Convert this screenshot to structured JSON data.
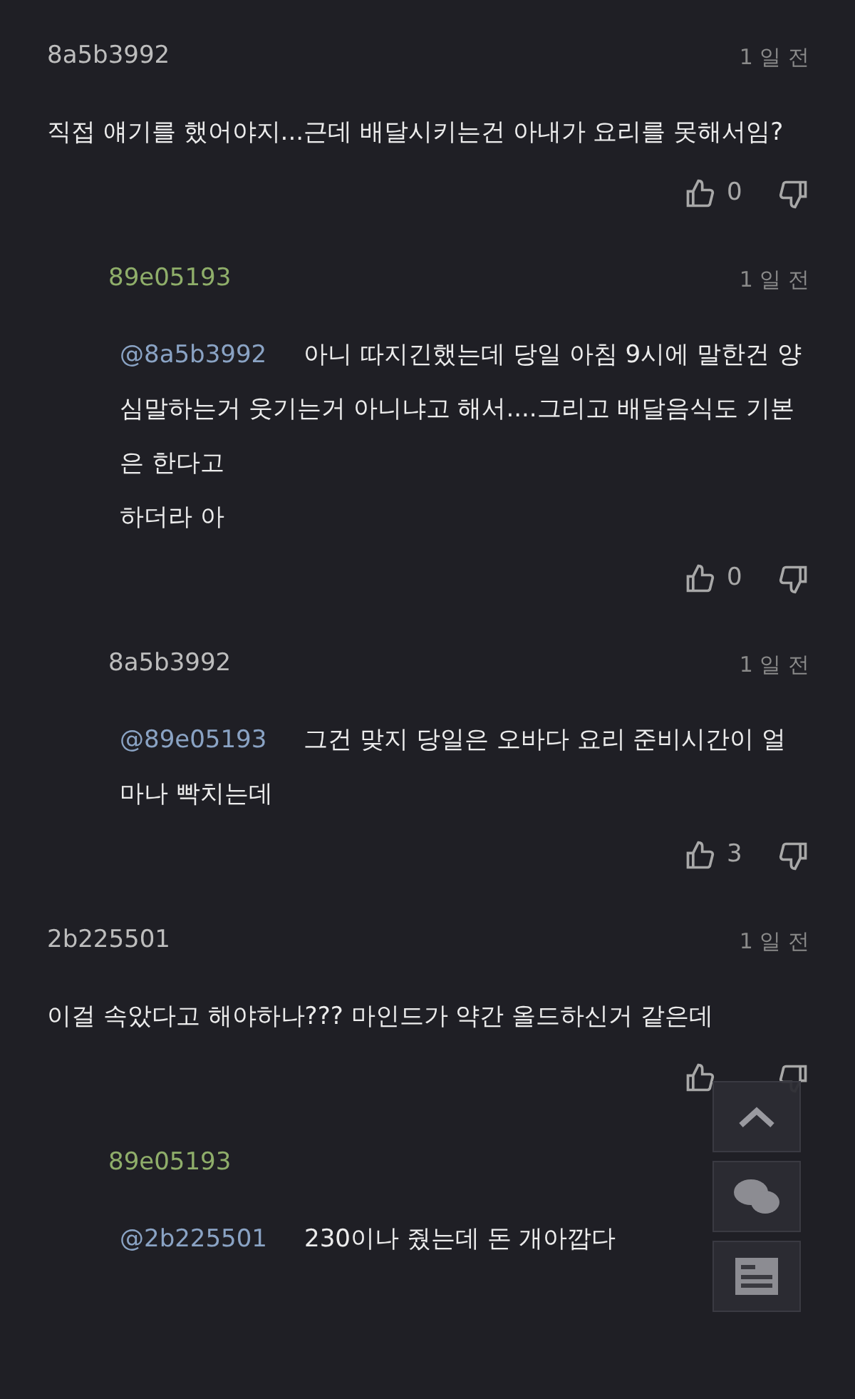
{
  "comments": [
    {
      "user": "8a5b3992",
      "author": false,
      "time": "1 일 전",
      "text": "직접 얘기를 했어야지...근데 배달시키는건 아내가 요리를 못해서임?",
      "show_votes": true,
      "likes": "0",
      "replies": [
        {
          "user": "89e05193",
          "author": true,
          "time": "1 일 전",
          "mention": "@8a5b3992",
          "text": "아니 따지긴했는데 당일 아침 9시에 말한건 양심말하는거 웃기는거 아니냐고 해서....그리고 배달음식도 기본은 한다고\n하더라 아",
          "show_votes": true,
          "likes": "0"
        },
        {
          "user": "8a5b3992",
          "author": false,
          "time": "1 일 전",
          "mention": "@89e05193",
          "text": "그건 맞지 당일은 오바다 요리 준비시간이 얼마나 빡치는데",
          "show_votes": true,
          "likes": "3"
        }
      ]
    },
    {
      "user": "2b225501",
      "author": false,
      "time": "1 일 전",
      "text": "이걸 속았다고 해야하나??? 마인드가 약간 올드하신거 같은데",
      "show_votes": true,
      "replies": [
        {
          "user": "89e05193",
          "author": true,
          "mention": "@2b225501",
          "text": "230이나 줬는데 돈 개아깝다",
          "show_votes": false
        }
      ]
    }
  ],
  "floating_buttons": [
    {
      "kind": "top"
    },
    {
      "kind": "comments"
    },
    {
      "kind": "reader"
    }
  ]
}
